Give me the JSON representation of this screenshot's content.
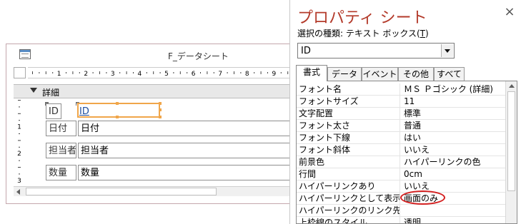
{
  "form": {
    "title": "F_データシート",
    "section_label": "詳細",
    "controls": [
      {
        "label": "ID",
        "field": "ID"
      },
      {
        "label": "日付",
        "field": "日付"
      },
      {
        "label": "担当者",
        "field": "担当者"
      },
      {
        "label": "数量",
        "field": "数量"
      }
    ],
    "ruler_numbers": [
      "1",
      "2",
      "3",
      "4",
      "5",
      "6",
      "7",
      "8",
      "9"
    ],
    "vertical_ruler_numbers": [
      "1",
      "2",
      "3"
    ]
  },
  "property_sheet": {
    "title": "プロパティ シート",
    "selection_type_label": "選択の種類: テキスト ボックス(",
    "selection_type_accel": "T",
    "selection_type_end": ")",
    "object_combo_value": "ID",
    "close_icon": "×",
    "tabs": [
      "書式",
      "データ",
      "イベント",
      "その他",
      "すべて"
    ],
    "active_tab": "書式",
    "rows": [
      {
        "name": "フォント名",
        "value": "ＭＳ Ｐゴシック (詳細)"
      },
      {
        "name": "フォントサイズ",
        "value": "11"
      },
      {
        "name": "文字配置",
        "value": "標準"
      },
      {
        "name": "フォント太さ",
        "value": "普通"
      },
      {
        "name": "フォント下線",
        "value": "はい"
      },
      {
        "name": "フォント斜体",
        "value": "いいえ"
      },
      {
        "name": "前景色",
        "value": "ハイパーリンクの色"
      },
      {
        "name": "行間",
        "value": "0cm"
      },
      {
        "name": "ハイパーリンクあり",
        "value": "いいえ"
      },
      {
        "name": "ハイパーリンクとして表示",
        "value": "画面のみ"
      },
      {
        "name": "ハイパーリンクのリンク先",
        "value": ""
      },
      {
        "name": "上枠線のスタイル",
        "value": "透明"
      }
    ]
  },
  "colors": {
    "prop_title": "#b33a2a",
    "selection_border": "#f0a64a",
    "highlight_oval": "#d42020",
    "hyperlink": "#1f4e9e"
  }
}
